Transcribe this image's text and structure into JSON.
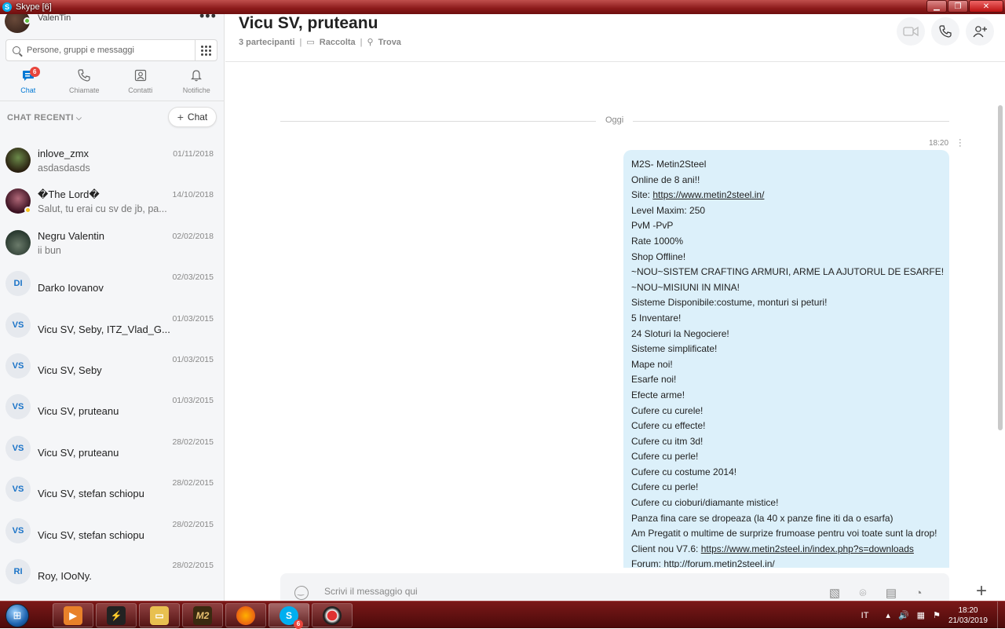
{
  "window": {
    "title": "Skype [6]"
  },
  "profile": {
    "name": "ValenTin"
  },
  "search": {
    "placeholder": "Persone, gruppi e messaggi"
  },
  "nav": {
    "tabs": [
      {
        "label": "Chat",
        "badge": "6"
      },
      {
        "label": "Chiamate"
      },
      {
        "label": "Contatti"
      },
      {
        "label": "Notifiche"
      }
    ]
  },
  "recent": {
    "label": "CHAT RECENTI",
    "new_chat_label": "Chat"
  },
  "chats": [
    {
      "name": "inlove_zmx",
      "preview": "asdasdasds",
      "date": "01/11/2018",
      "avatar": ""
    },
    {
      "name": "�The Lord�",
      "preview": "Salut, tu erai cu sv de jb, pa...",
      "date": "14/10/2018",
      "avatar": ""
    },
    {
      "name": "Negru Valentin",
      "preview": "ii bun",
      "date": "02/02/2018",
      "avatar": ""
    },
    {
      "name": "Darko Iovanov",
      "preview": "",
      "date": "02/03/2015",
      "avatar": "DI"
    },
    {
      "name": "Vicu SV, Seby, ITZ_Vlad_G...",
      "preview": "",
      "date": "01/03/2015",
      "avatar": "VS"
    },
    {
      "name": "Vicu SV, Seby",
      "preview": "",
      "date": "01/03/2015",
      "avatar": "VS"
    },
    {
      "name": "Vicu SV, pruteanu",
      "preview": "",
      "date": "01/03/2015",
      "avatar": "VS"
    },
    {
      "name": "Vicu SV, pruteanu",
      "preview": "",
      "date": "28/02/2015",
      "avatar": "VS"
    },
    {
      "name": "Vicu SV, stefan schiopu",
      "preview": "",
      "date": "28/02/2015",
      "avatar": "VS"
    },
    {
      "name": "Vicu SV, stefan schiopu",
      "preview": "",
      "date": "28/02/2015",
      "avatar": "VS"
    },
    {
      "name": "Roy, IOoNy.",
      "preview": "",
      "date": "28/02/2015",
      "avatar": "RI"
    }
  ],
  "conversation": {
    "title": "Vicu SV, pruteanu",
    "participants": "3 partecipanti",
    "gallery": "Raccolta",
    "find": "Trova",
    "day_label": "Oggi",
    "message_time": "18:20",
    "message_lines": [
      "M2S- Metin2Steel",
      "Online de 8 ani!!",
      "Site: https://www.metin2steel.in/",
      "Level Maxim: 250",
      "PvM -PvP",
      "Rate 1000%",
      "Shop Offline!",
      "~NOU~SISTEM CRAFTING ARMURI, ARME LA AJUTORUL DE ESARFE!",
      "~NOU~MISIUNI IN MINA!",
      "Sisteme Disponibile:costume, monturi si peturi!",
      "5 Inventare!",
      "24 Sloturi la Negociere!",
      "Sisteme simplificate!",
      "Mape noi!",
      "Esarfe noi!",
      "Efecte arme!",
      "Cufere cu curele!",
      "Cufere cu effecte!",
      "Cufere cu itm 3d!",
      "Cufere cu perle!",
      "Cufere cu costume 2014!",
      "Cufere cu perle!",
      "Cufere cu cioburi/diamante mistice!",
      "Panza fina care se dropeaza (la 40 x panze fine iti da o esarfa)",
      "Am Pregatit o multime de surprize frumoase pentru voi toate sunt la drop!",
      "Client nou V7.6: https://www.metin2steel.in/index.php?s=downloads",
      "Forum: http://forum.metin2steel.in/"
    ],
    "composer_placeholder": "Scrivi il messaggio qui"
  },
  "taskbar": {
    "skype_badge": "6",
    "m2_label": "M2",
    "lang": "IT",
    "time": "18:20",
    "date": "21/03/2019"
  }
}
